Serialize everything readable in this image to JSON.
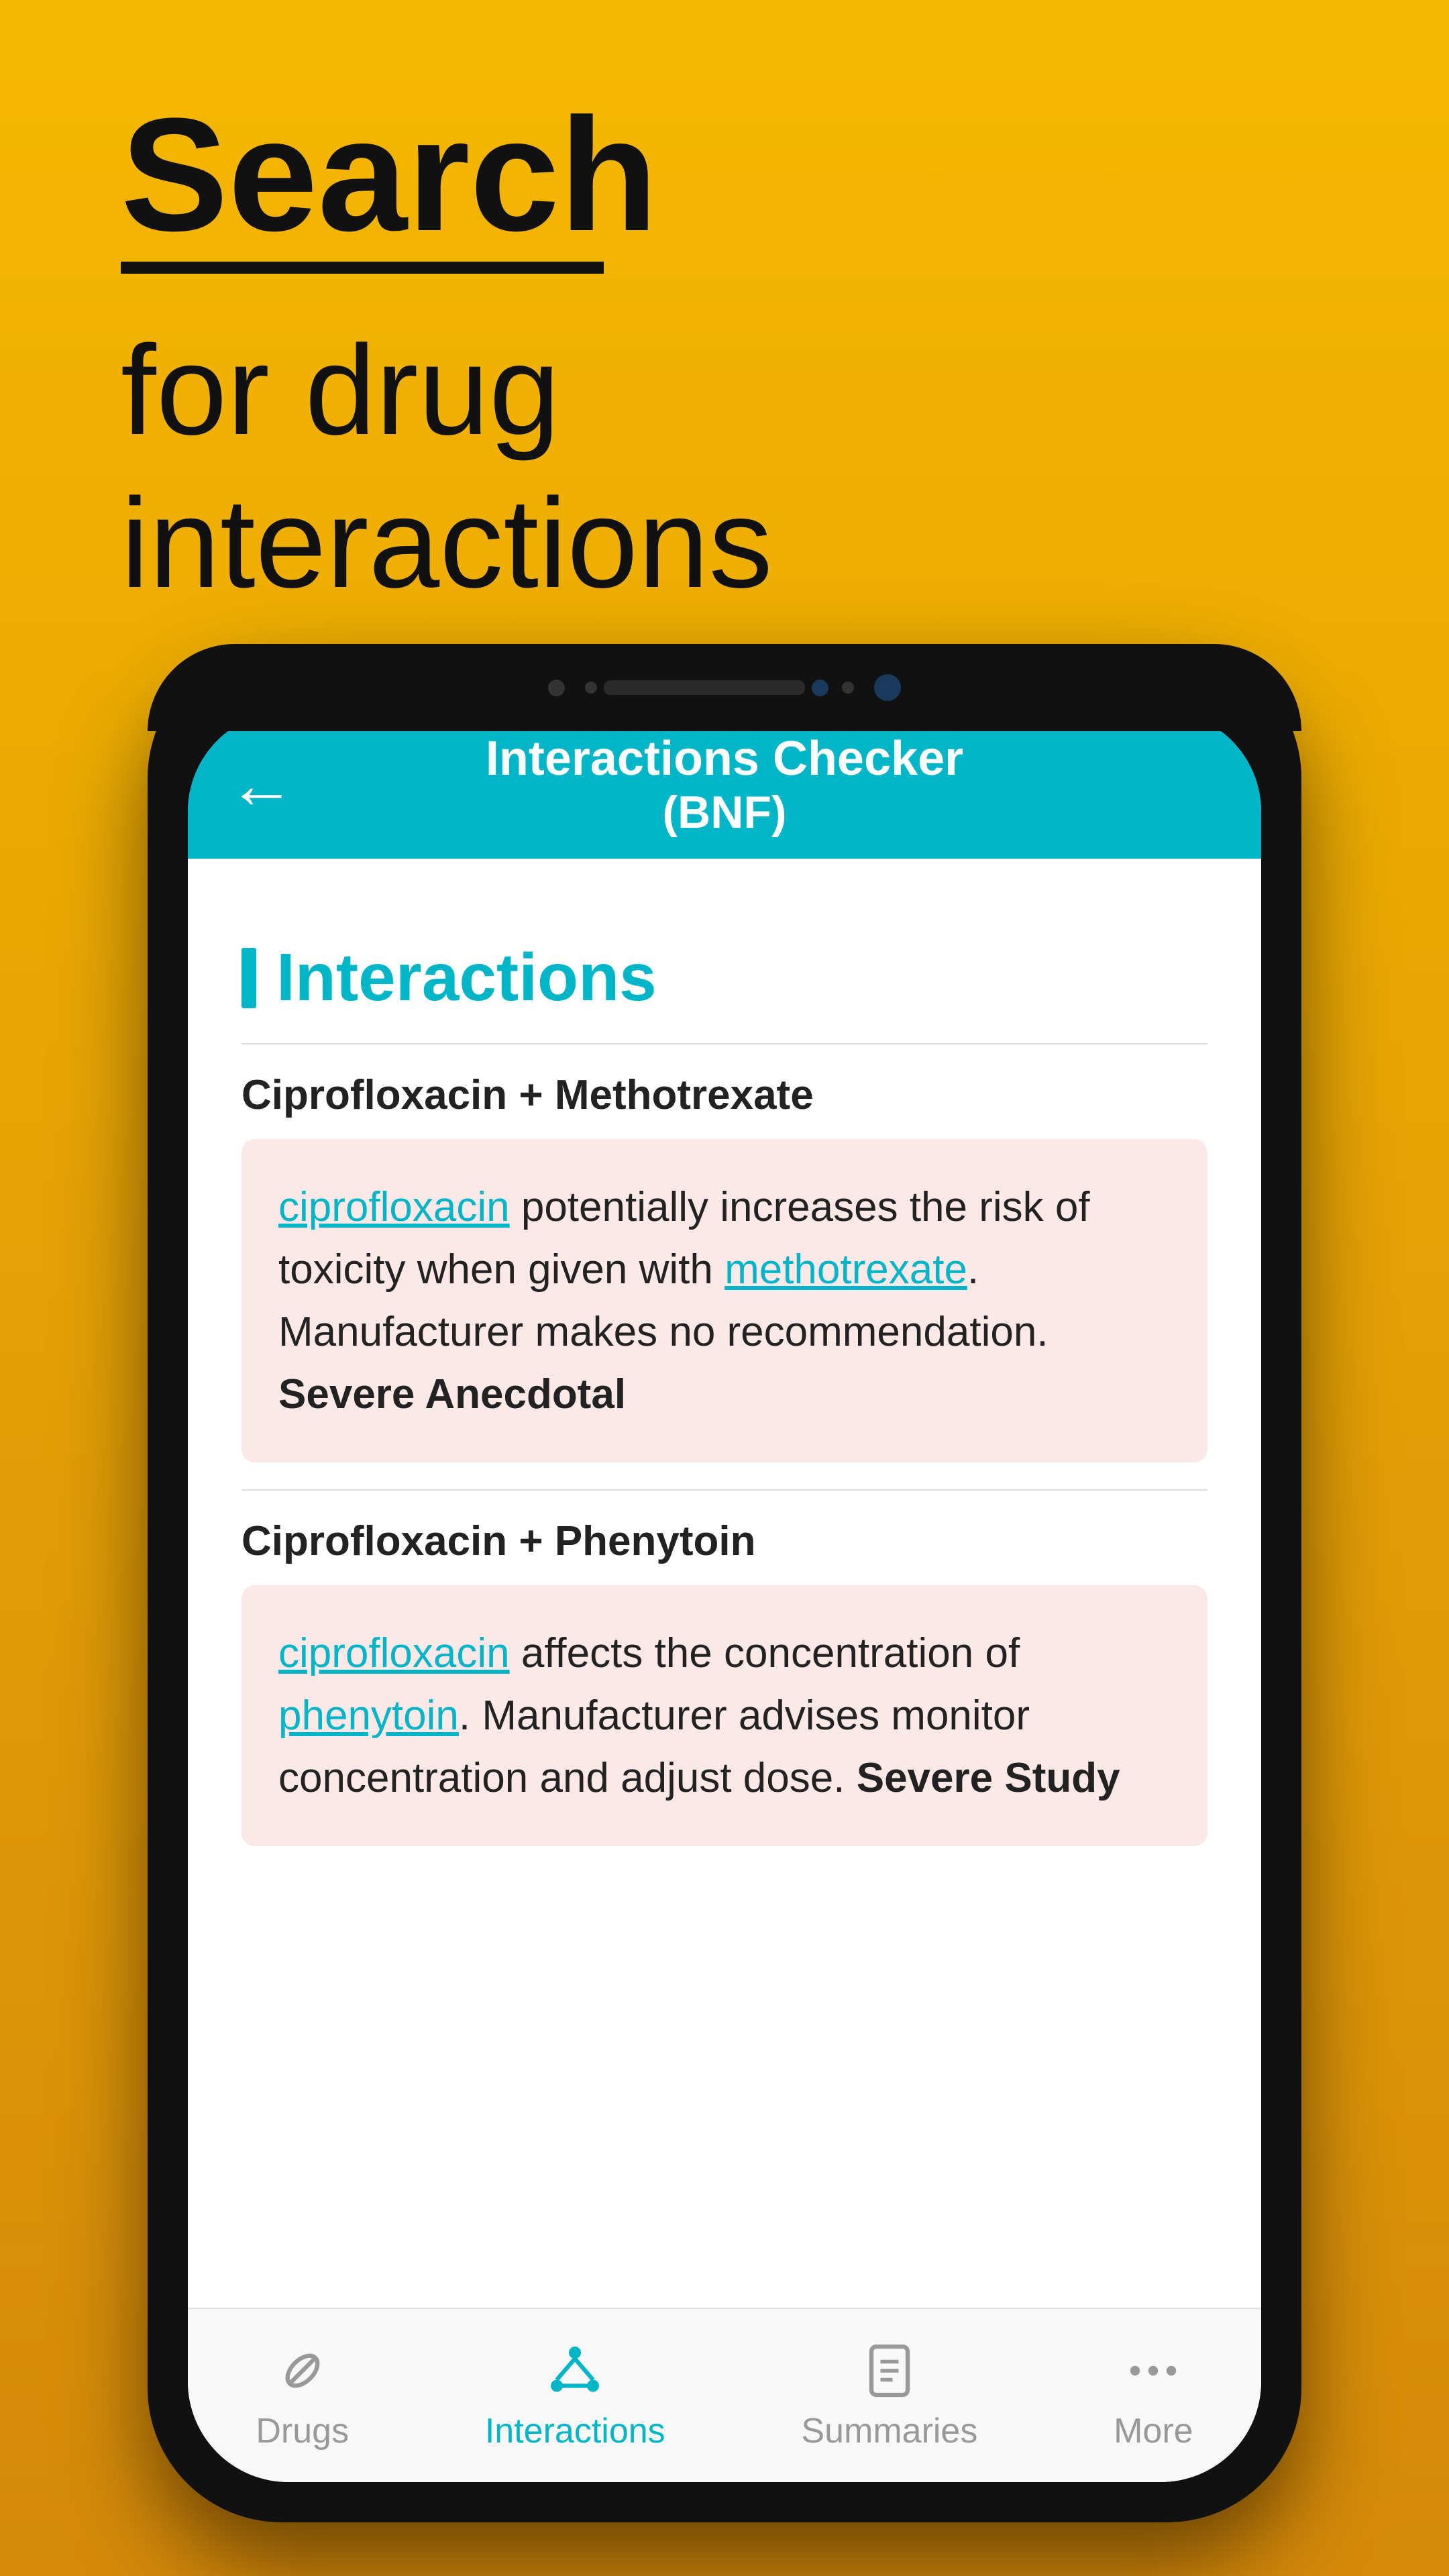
{
  "background": {
    "color_top": "#F5B800",
    "color_bottom": "#D4890A"
  },
  "hero": {
    "search_label": "Search",
    "subtitle_line1": "for drug",
    "subtitle_line2": "interactions"
  },
  "app_bar": {
    "back_icon": "←",
    "title_line1": "Interactions Checker",
    "title_line2": "(BNF)"
  },
  "section": {
    "heading": "Interactions"
  },
  "interactions": [
    {
      "pair": "Ciprofloxacin + Methotrexate",
      "drug1": "ciprofloxacin",
      "text_middle": " potentially increases the risk of toxicity when given with ",
      "drug2": "methotrexate",
      "text_end": ". Manufacturer makes no recommendation.",
      "severity": "Severe Anecdotal"
    },
    {
      "pair": "Ciprofloxacin + Phenytoin",
      "drug1": "ciprofloxacin",
      "text_middle": " affects the concentration of ",
      "drug2": "phenytoin",
      "text_end": ". Manufacturer advises monitor concentration and adjust dose.",
      "severity": "Severe Study"
    }
  ],
  "bottom_nav": {
    "items": [
      {
        "label": "Drugs",
        "active": false
      },
      {
        "label": "Interactions",
        "active": true
      },
      {
        "label": "Summaries",
        "active": false
      },
      {
        "label": "More",
        "active": false
      }
    ]
  }
}
